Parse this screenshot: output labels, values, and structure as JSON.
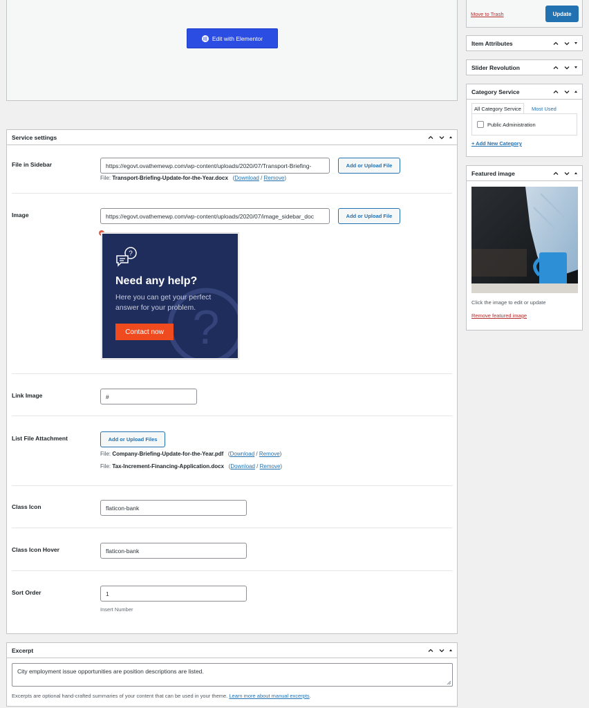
{
  "editor": {
    "elementor_button": "Edit with Elementor"
  },
  "service_settings": {
    "title": "Service settings",
    "file_in_sidebar": {
      "label": "File in Sidebar",
      "value": "https://egovt.ovathemewp.com/wp-content/uploads/2020/07/Transport-Briefing-",
      "button": "Add or Upload File",
      "file_prefix": "File:",
      "file_name": "Transport-Briefing-Update-for-the-Year.docx",
      "download": "Download",
      "remove": "Remove"
    },
    "image": {
      "label": "Image",
      "value": "https://egovt.ovathemewp.com/wp-content/uploads/2020/07/image_sidebar_doc",
      "button": "Add or Upload File",
      "preview": {
        "heading": "Need any help?",
        "line1": "Here you can get your perfect",
        "line2": "answer for your problem.",
        "cta": "Contact now"
      }
    },
    "link_image": {
      "label": "Link Image",
      "value": "#"
    },
    "list_file_attachment": {
      "label": "List File Attachment",
      "button": "Add or Upload Files",
      "files": [
        {
          "prefix": "File:",
          "name": "Company-Briefing-Update-for-the-Year.pdf",
          "download": "Download",
          "remove": "Remove"
        },
        {
          "prefix": "File:",
          "name": "Tax-Increment-Financing-Application.docx",
          "download": "Download",
          "remove": "Remove"
        }
      ]
    },
    "class_icon": {
      "label": "Class Icon",
      "value": "flaticon-bank"
    },
    "class_icon_hover": {
      "label": "Class Icon Hover",
      "value": "flaticon-bank"
    },
    "sort_order": {
      "label": "Sort Order",
      "value": "1",
      "help": "Insert Number"
    }
  },
  "excerpt": {
    "title": "Excerpt",
    "value": "City employment issue opportunities are position descriptions are listed.",
    "help": "Excerpts are optional hand-crafted summaries of your content that can be used in your theme.",
    "learn_more": "Learn more about manual excerpts"
  },
  "sidebar": {
    "publish": {
      "trash": "Move to Trash",
      "update": "Update"
    },
    "item_attributes": {
      "title": "Item Attributes"
    },
    "slider_revolution": {
      "title": "Slider Revolution"
    },
    "category_service": {
      "title": "Category Service",
      "tab_all": "All Category Service",
      "tab_most": "Most Used",
      "item": "Public Administration",
      "add_new": "+ Add New Category"
    },
    "featured_image": {
      "title": "Featured image",
      "hint": "Click the image to edit or update",
      "remove": "Remove featured image"
    }
  },
  "colors": {
    "accent": "#2271b1",
    "elementor": "#2b4de2",
    "danger": "#b32d2e",
    "promo_bg": "#1f2d5c",
    "promo_cta": "#f04a1f"
  }
}
